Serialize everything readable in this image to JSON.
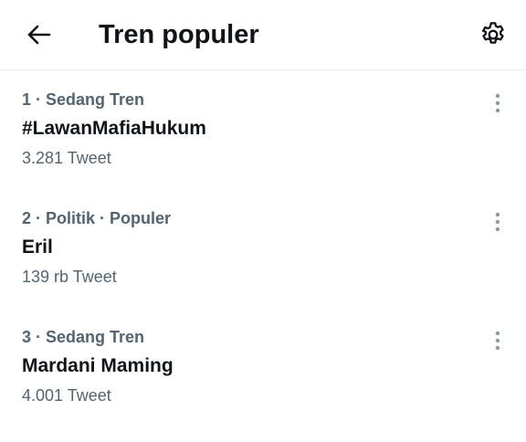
{
  "header": {
    "title": "Tren populer",
    "back_icon": "arrow-left-icon",
    "settings_icon": "gear-icon"
  },
  "colors": {
    "text_primary": "#0f1419",
    "text_secondary": "#536471",
    "more_icon": "#8899a6",
    "divider": "#e6ecf0"
  },
  "trends": [
    {
      "meta": "1 · Sedang Tren",
      "name": "#LawanMafiaHukum",
      "count": "3.281 Tweet"
    },
    {
      "meta": "2 · Politik · Populer",
      "name": "Eril",
      "count": "139 rb Tweet"
    },
    {
      "meta": "3 · Sedang Tren",
      "name": "Mardani Maming",
      "count": "4.001 Tweet"
    }
  ]
}
